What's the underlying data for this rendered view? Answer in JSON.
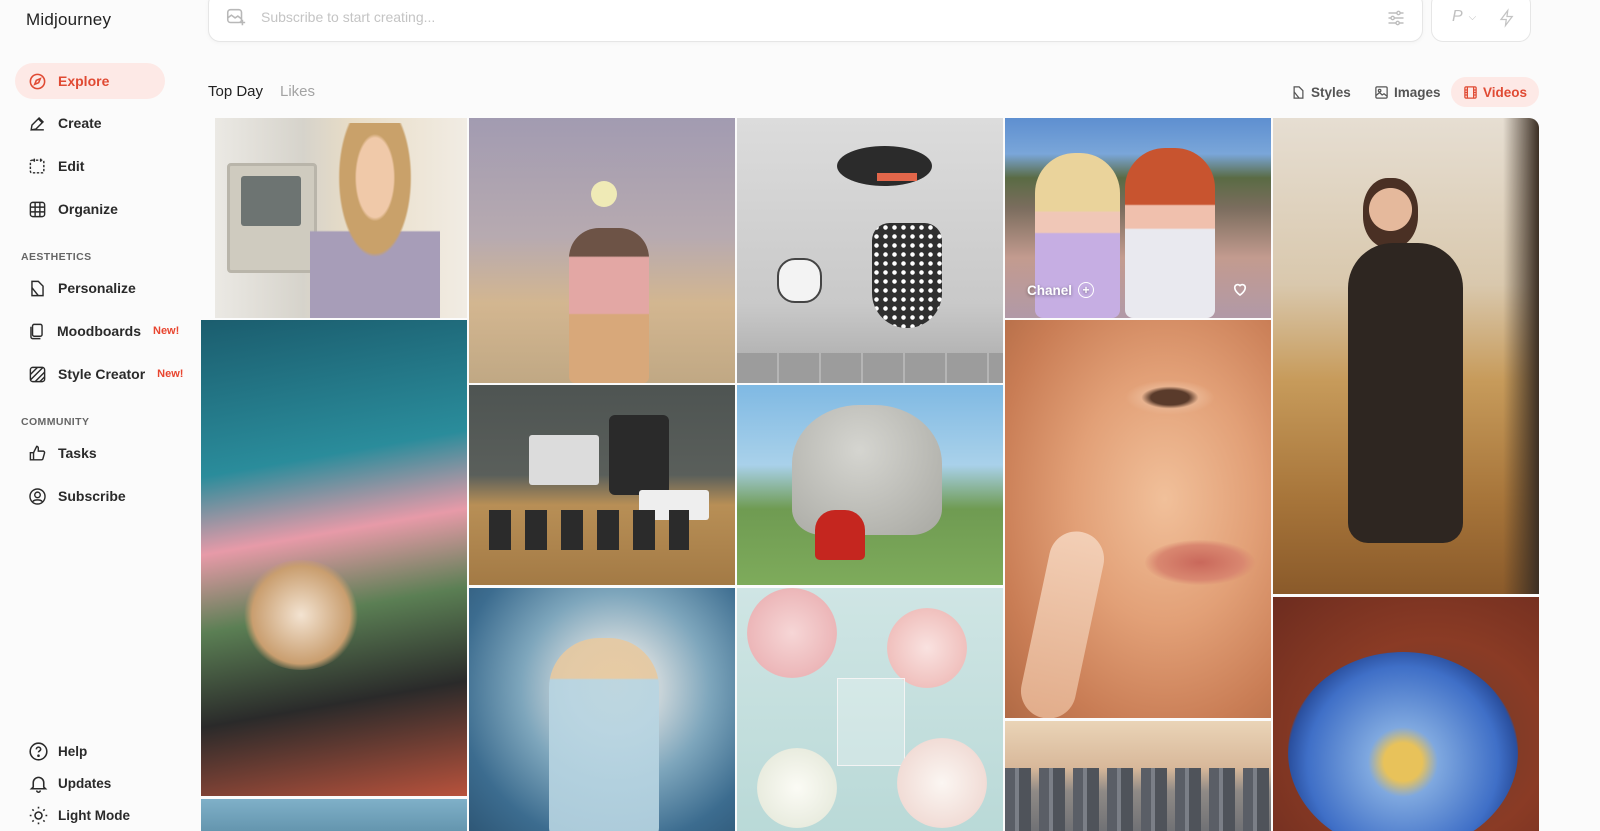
{
  "app": {
    "title": "Midjourney"
  },
  "sidebar": {
    "items": [
      {
        "label": "Explore",
        "icon": "compass-icon"
      },
      {
        "label": "Create",
        "icon": "brush-icon"
      },
      {
        "label": "Edit",
        "icon": "edit-icon"
      },
      {
        "label": "Organize",
        "icon": "grid-icon"
      }
    ],
    "aesthetics_label": "AESTHETICS",
    "aesthetics": [
      {
        "label": "Personalize",
        "icon": "personalize-icon",
        "badge": ""
      },
      {
        "label": "Moodboards",
        "icon": "moodboard-icon",
        "badge": "New!"
      },
      {
        "label": "Style Creator",
        "icon": "style-creator-icon",
        "badge": "New!"
      }
    ],
    "community_label": "COMMUNITY",
    "community": [
      {
        "label": "Tasks",
        "icon": "thumbs-up-icon"
      },
      {
        "label": "Subscribe",
        "icon": "user-circle-icon"
      }
    ],
    "bottom": [
      {
        "label": "Help",
        "icon": "help-icon"
      },
      {
        "label": "Updates",
        "icon": "bell-icon"
      },
      {
        "label": "Light Mode",
        "icon": "sun-icon"
      }
    ]
  },
  "prompt": {
    "placeholder": "Subscribe to start creating..."
  },
  "mode": {
    "label": "P"
  },
  "tabs": [
    {
      "label": "Top Day"
    },
    {
      "label": "Likes"
    }
  ],
  "filters": [
    {
      "label": "Styles",
      "icon": "styles-icon"
    },
    {
      "label": "Images",
      "icon": "image-icon"
    },
    {
      "label": "Videos",
      "icon": "video-icon"
    }
  ],
  "gallery": {
    "hover_card": {
      "label": "Chanel"
    }
  },
  "colors": {
    "accent": "#e04a33",
    "accent_bg": "#fde9e6"
  }
}
